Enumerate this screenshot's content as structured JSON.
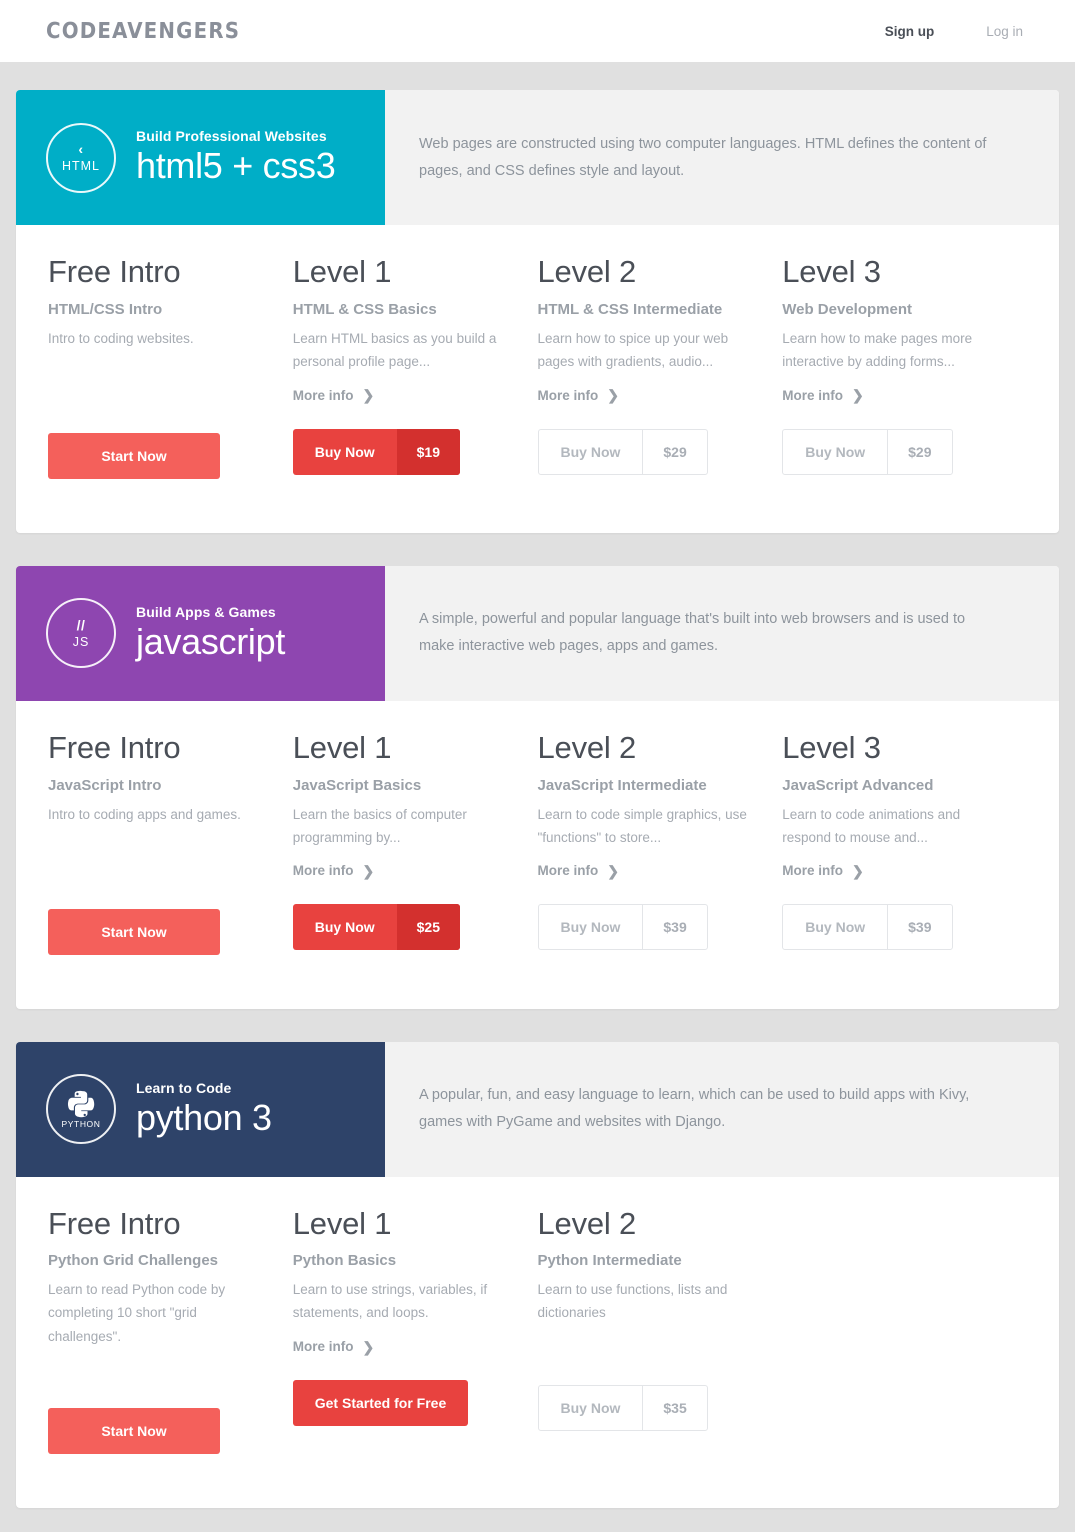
{
  "header": {
    "logo": "CODEAVENGERS",
    "nav": [
      {
        "label": "Sign up",
        "name": "signup"
      },
      {
        "label": "Log in",
        "name": "login"
      }
    ]
  },
  "colors": {
    "html_accent": "#00aec7",
    "js_accent": "#8e46b0",
    "python_accent": "#2e4369",
    "primary_red": "#f4605b",
    "dark_red": "#e8423f",
    "price_red": "#d3302e",
    "page_bg": "#e0e0e0",
    "desc_bg": "#f2f2f2"
  },
  "cards": [
    {
      "id": "html",
      "accent": "#00aec7",
      "badge_mark": "‹",
      "badge_word": "HTML",
      "kicker": "Build Professional Websites",
      "language": "html5 + css3",
      "description": "Web pages are constructed using two computer languages. HTML defines the content of pages, and CSS defines style and layout.",
      "courses": [
        {
          "level": "Free Intro",
          "subtitle": "HTML/CSS Intro",
          "blurb": "Intro to coding websites.",
          "more_info": "",
          "button": {
            "kind": "start",
            "label": "Start Now",
            "price": ""
          }
        },
        {
          "level": "Level 1",
          "subtitle": "HTML & CSS Basics",
          "blurb": "Learn HTML basics as you build a personal profile page...",
          "more_info": "More info",
          "button": {
            "kind": "buy-filled",
            "label": "Buy Now",
            "price": "$19"
          }
        },
        {
          "level": "Level 2",
          "subtitle": "HTML & CSS Intermediate",
          "blurb": "Learn how to spice up your web pages with gradients, audio...",
          "more_info": "More info",
          "button": {
            "kind": "buy-outline",
            "label": "Buy Now",
            "price": "$29"
          }
        },
        {
          "level": "Level 3",
          "subtitle": "Web Development",
          "blurb": "Learn how to make pages more interactive by adding forms...",
          "more_info": "More info",
          "button": {
            "kind": "buy-outline",
            "label": "Buy Now",
            "price": "$29"
          }
        }
      ]
    },
    {
      "id": "javascript",
      "accent": "#8e46b0",
      "badge_mark": "//",
      "badge_word": "JS",
      "kicker": "Build Apps & Games",
      "language": "javascript",
      "description": "A simple, powerful and popular language that's built into web browsers and is used to make interactive web pages, apps and games.",
      "courses": [
        {
          "level": "Free Intro",
          "subtitle": "JavaScript Intro",
          "blurb": "Intro to coding apps and games.",
          "more_info": "",
          "button": {
            "kind": "start",
            "label": "Start Now",
            "price": ""
          }
        },
        {
          "level": "Level 1",
          "subtitle": "JavaScript Basics",
          "blurb": "Learn the basics of computer programming by...",
          "more_info": "More info",
          "button": {
            "kind": "buy-filled",
            "label": "Buy Now",
            "price": "$25"
          }
        },
        {
          "level": "Level 2",
          "subtitle": "JavaScript Intermediate",
          "blurb": "Learn to code simple graphics, use \"functions\" to store...",
          "more_info": "More info",
          "button": {
            "kind": "buy-outline",
            "label": "Buy Now",
            "price": "$39"
          }
        },
        {
          "level": "Level 3",
          "subtitle": "JavaScript Advanced",
          "blurb": "Learn to code animations and respond to mouse and...",
          "more_info": "More info",
          "button": {
            "kind": "buy-outline",
            "label": "Buy Now",
            "price": "$39"
          }
        }
      ]
    },
    {
      "id": "python",
      "accent": "#2e4369",
      "badge_mark": "python-logo-icon",
      "badge_word": "PYTHON",
      "kicker": "Learn to Code",
      "language": "python 3",
      "description": "A popular, fun, and easy language to learn, which can be used to build apps with Kivy, games with PyGame and websites with Django.",
      "courses": [
        {
          "level": "Free Intro",
          "subtitle": "Python Grid Challenges",
          "blurb": "Learn to read Python code by completing 10 short \"grid challenges\".",
          "more_info": "",
          "button": {
            "kind": "start",
            "label": "Start Now",
            "price": ""
          }
        },
        {
          "level": "Level 1",
          "subtitle": "Python Basics",
          "blurb": "Learn to use strings, variables, if statements, and loops.",
          "more_info": "More info",
          "button": {
            "kind": "free-filled",
            "label": "Get Started for Free",
            "price": ""
          }
        },
        {
          "level": "Level 2",
          "subtitle": "Python Intermediate",
          "blurb": "Learn to use functions, lists and dictionaries",
          "more_info": "",
          "button": {
            "kind": "buy-outline",
            "label": "Buy Now",
            "price": "$35"
          }
        }
      ]
    }
  ]
}
